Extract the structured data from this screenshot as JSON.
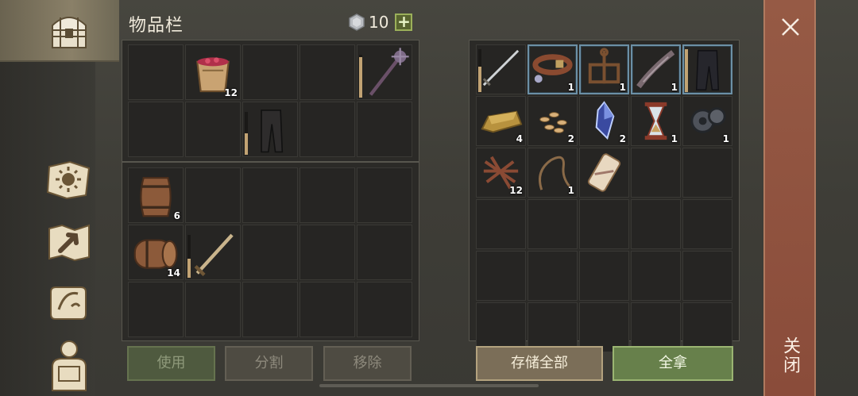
{
  "inventory": {
    "title": "物品栏",
    "currency": {
      "icon": "silver-coin-icon",
      "amount": "10",
      "add_label": "+"
    }
  },
  "nav": [
    {
      "name": "chest-icon",
      "active": true
    },
    {
      "name": "sun-book-icon",
      "active": false
    },
    {
      "name": "treasure-map-icon",
      "active": false
    },
    {
      "name": "quest-scroll-icon",
      "active": false
    },
    {
      "name": "character-backpack-icon",
      "active": false
    }
  ],
  "pockets": [
    {
      "item": null
    },
    {
      "item": {
        "icon": "berry-bucket-icon",
        "count": "12"
      }
    },
    {
      "item": null
    },
    {
      "item": null
    },
    {
      "item": {
        "icon": "spiked-mace-icon",
        "durability": 0.95
      }
    },
    {
      "item": null
    },
    {
      "item": null
    },
    {
      "item": {
        "icon": "leather-pants-icon",
        "durability": 0.5
      }
    },
    {
      "item": null
    },
    {
      "item": null
    }
  ],
  "backpack": [
    {
      "item": {
        "icon": "wooden-barrel-icon",
        "count": "6"
      }
    },
    {
      "item": null
    },
    {
      "item": null
    },
    {
      "item": null
    },
    {
      "item": null
    },
    {
      "item": {
        "icon": "rolled-barrel-icon",
        "count": "14"
      }
    },
    {
      "item": {
        "icon": "sword-icon",
        "durability": 0.45
      }
    },
    {
      "item": null
    },
    {
      "item": null
    },
    {
      "item": null
    },
    {
      "item": null
    },
    {
      "item": null
    },
    {
      "item": null
    },
    {
      "item": null
    },
    {
      "item": null
    }
  ],
  "storage": [
    {
      "item": {
        "icon": "longsword-icon",
        "durability": 0.6
      }
    },
    {
      "item": {
        "icon": "collar-icon",
        "count": "1"
      },
      "selected": true
    },
    {
      "item": {
        "icon": "anchor-rack-icon",
        "count": "1"
      },
      "selected": true
    },
    {
      "item": {
        "icon": "serpent-bow-icon",
        "count": "1"
      },
      "selected": true
    },
    {
      "item": {
        "icon": "dark-pants-icon",
        "durability": 1.0
      },
      "selected": true
    },
    {
      "item": {
        "icon": "gold-ingot-icon",
        "count": "4"
      }
    },
    {
      "item": {
        "icon": "seeds-icon",
        "count": "2"
      }
    },
    {
      "item": {
        "icon": "crystal-shard-icon",
        "count": "2"
      }
    },
    {
      "item": {
        "icon": "hourglass-icon",
        "count": "1"
      }
    },
    {
      "item": {
        "icon": "gear-mechanism-icon",
        "count": "1"
      }
    },
    {
      "item": {
        "icon": "leather-straps-icon",
        "count": "12"
      }
    },
    {
      "item": {
        "icon": "rope-whip-icon",
        "count": "1"
      }
    },
    {
      "item": {
        "icon": "parchment-roll-icon"
      }
    },
    {
      "item": null
    },
    {
      "item": null
    },
    {
      "item": null
    },
    {
      "item": null
    },
    {
      "item": null
    },
    {
      "item": null
    },
    {
      "item": null
    },
    {
      "item": null
    },
    {
      "item": null
    },
    {
      "item": null
    },
    {
      "item": null
    },
    {
      "item": null
    },
    {
      "item": null
    },
    {
      "item": null
    },
    {
      "item": null
    },
    {
      "item": null
    },
    {
      "item": null
    }
  ],
  "buttons": {
    "use": "使用",
    "split": "分割",
    "remove": "移除",
    "store_all": "存储全部",
    "take_all": "全拿"
  },
  "close": {
    "label": "关闭",
    "icon": "close-icon"
  },
  "colors": {
    "accent_green": "#67804b",
    "close_panel": "#8a4c3a",
    "selected_border": "#6c90a6"
  }
}
